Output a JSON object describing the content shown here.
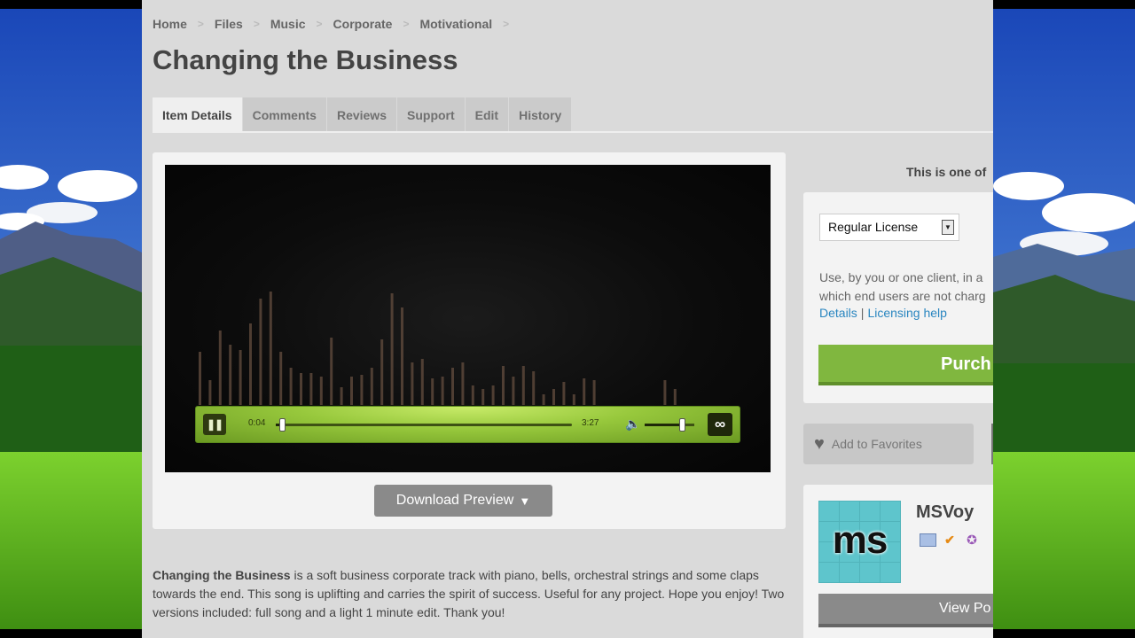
{
  "breadcrumb": [
    "Home",
    "Files",
    "Music",
    "Corporate",
    "Motivational"
  ],
  "breadcrumb_separator": ">",
  "title": "Changing the Business",
  "tabs": [
    "Item Details",
    "Comments",
    "Reviews",
    "Support",
    "Edit",
    "History"
  ],
  "active_tab": "Item Details",
  "player": {
    "current_time": "0:04",
    "total_time": "3:27",
    "progress": 0.02,
    "volume": 0.75,
    "pause_glyph": "❚❚",
    "loop_glyph": "∞",
    "volume_glyph": "🔈",
    "accent": "#8fc13a"
  },
  "download": {
    "label": "Download Preview",
    "icon": "▼"
  },
  "description": {
    "lead": "Changing the Business",
    "body": " is a soft business corporate track with piano, bells, orchestral strings and some claps towards the end. This song is uplifting and carries the spirit of success. Useful for any project. Hope you enjoy! Two versions included: full song and a light 1 minute edit. Thank you!"
  },
  "sidebar": {
    "one_of": "This is one of",
    "license_select": "Regular License",
    "license_desc_line1": "Use, by you or one client, in a",
    "license_desc_line2": "which end users are not charg",
    "details_link": "Details",
    "licensing_help_link": "Licensing help",
    "link_separator": "|",
    "purchase_label": "Purch",
    "favorites_label": "Add to Favorites",
    "author_name": "MSVoy",
    "avatar_text": "ms",
    "view_portfolio_label": "View Po"
  },
  "colors": {
    "purchase": "#80b73f",
    "link": "#2a86c0",
    "page_bg": "#dadada"
  }
}
